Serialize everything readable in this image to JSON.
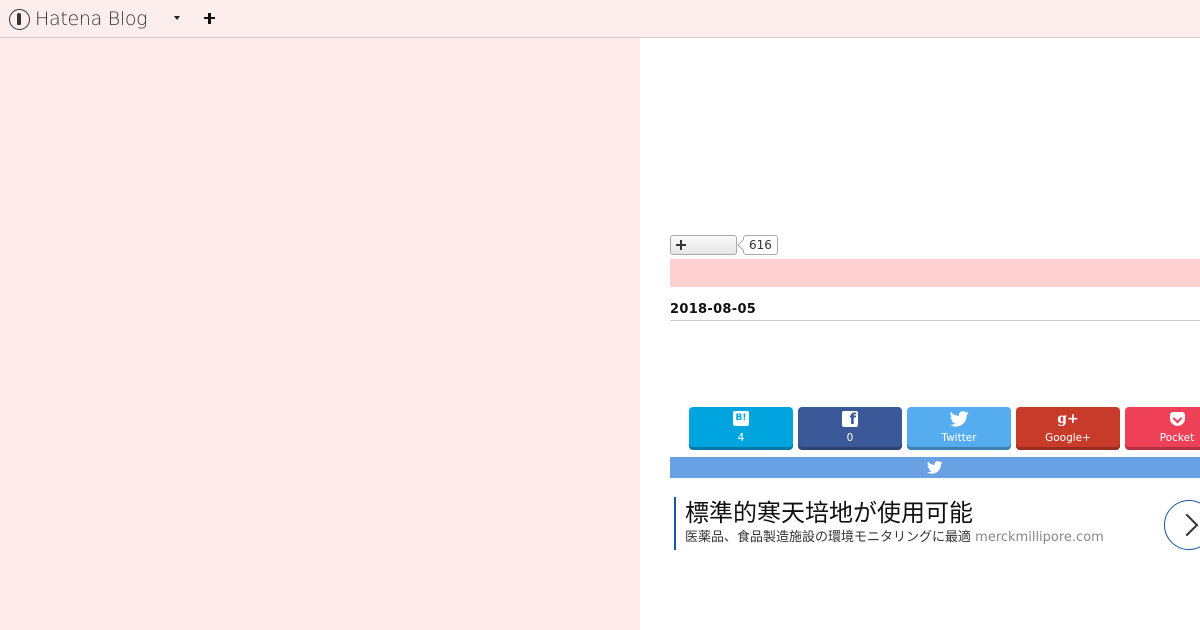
{
  "topbar": {
    "brand": "Hatena Blog"
  },
  "bookmark": {
    "count": "616"
  },
  "entry": {
    "date": "2018-08-05"
  },
  "share": [
    {
      "name": "hatena",
      "icon": "B!",
      "label": "4"
    },
    {
      "name": "facebook",
      "icon": "f",
      "label": "0"
    },
    {
      "name": "twitter",
      "label": "Twitter"
    },
    {
      "name": "google",
      "icon": "g+",
      "label": "Google+"
    },
    {
      "name": "pocket",
      "label": "Pocket"
    }
  ],
  "promo": {
    "title": "標準的寒天培地が使用可能",
    "description": "医薬品、食品製造施設の環境モニタリングに最適",
    "domain": "merckmillipore.com"
  },
  "colors": {
    "hatena": "#00a4de",
    "facebook": "#3b5998",
    "twitter": "#55acee",
    "google": "#c83a2a",
    "pocket": "#ee4056",
    "tweet_bar": "#6aa1e4",
    "pink_bar": "#ffd0d0",
    "left_pane": "#ffebea"
  }
}
